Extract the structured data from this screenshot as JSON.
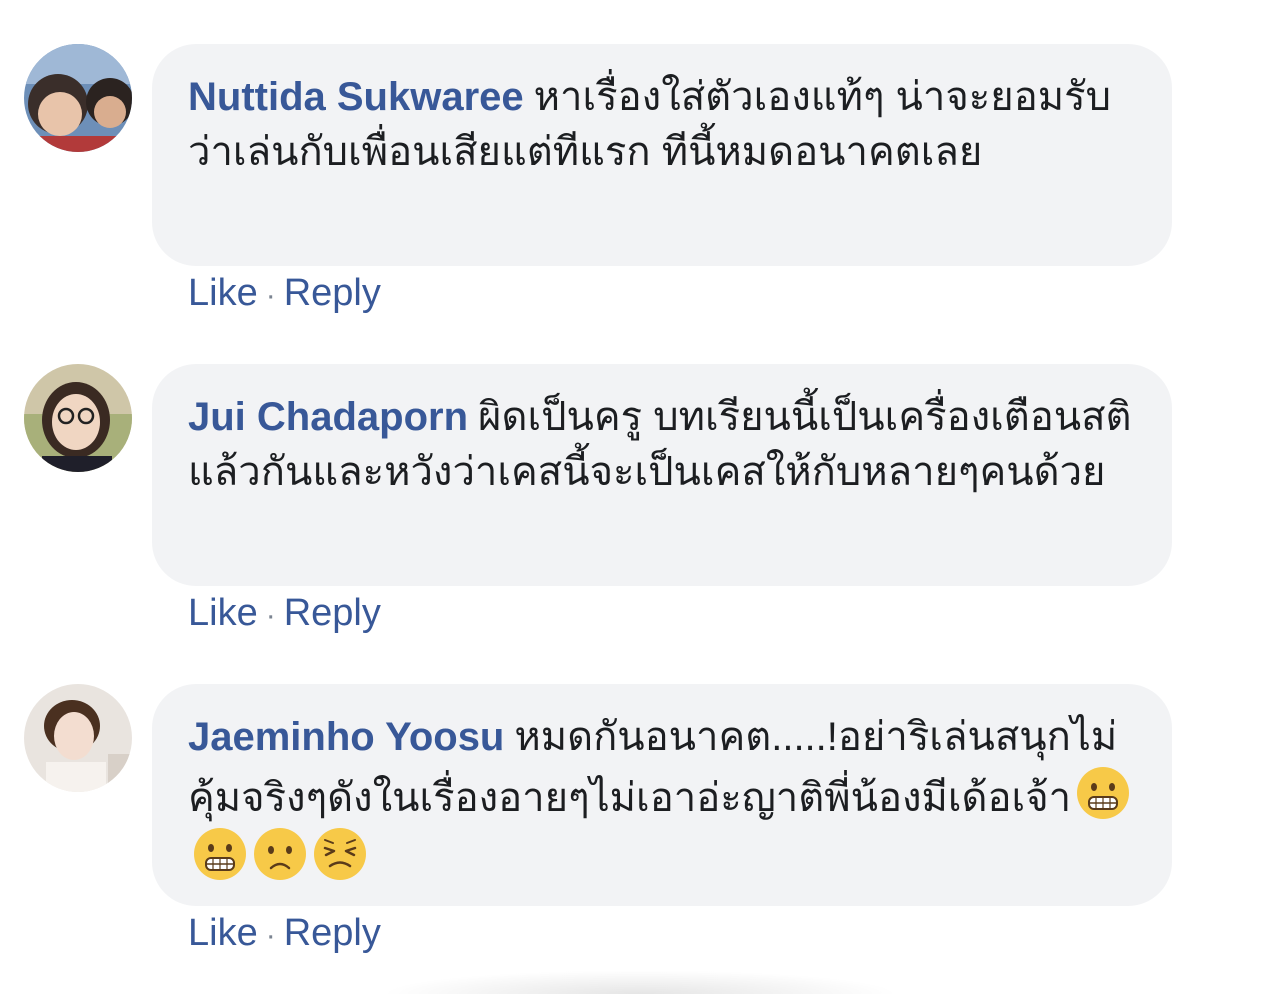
{
  "comments": [
    {
      "author": "Nuttida Sukwaree",
      "text": "หาเรื่องใส่ตัวเองแท้ๆ น่าจะยอมรับว่าเล่นกับเพื่อนเสียแต่ทีแรก ทีนี้หมดอนาคตเลย",
      "like_label": "Like",
      "separator": "·",
      "reply_label": "Reply"
    },
    {
      "author": "Jui Chadaporn",
      "text": "ผิดเป็นครู บทเรียนนี้เป็นเครื่องเตือนสติแล้วกันและหวังว่าเคสนี้จะเป็นเคสให้กับหลายๆคนด้วย",
      "like_label": "Like",
      "separator": "·",
      "reply_label": "Reply"
    },
    {
      "author": "Jaeminho Yoosu",
      "text": "หมดกันอนาคต.....!อย่าริเล่นสนุกไม่คุ้มจริงๆดังในเรื่องอายๆไม่เอาอ่ะญาติพี่น้องมีเด้อเจ้า",
      "emojis": [
        "grimacing-face-icon",
        "grimacing-face-icon",
        "frowning-face-icon",
        "tired-face-icon"
      ],
      "like_label": "Like",
      "separator": "·",
      "reply_label": "Reply"
    }
  ],
  "colors": {
    "author": "#385898",
    "bubble": "#f2f3f5",
    "text": "#1c1e21",
    "emoji": "#f7c948"
  }
}
